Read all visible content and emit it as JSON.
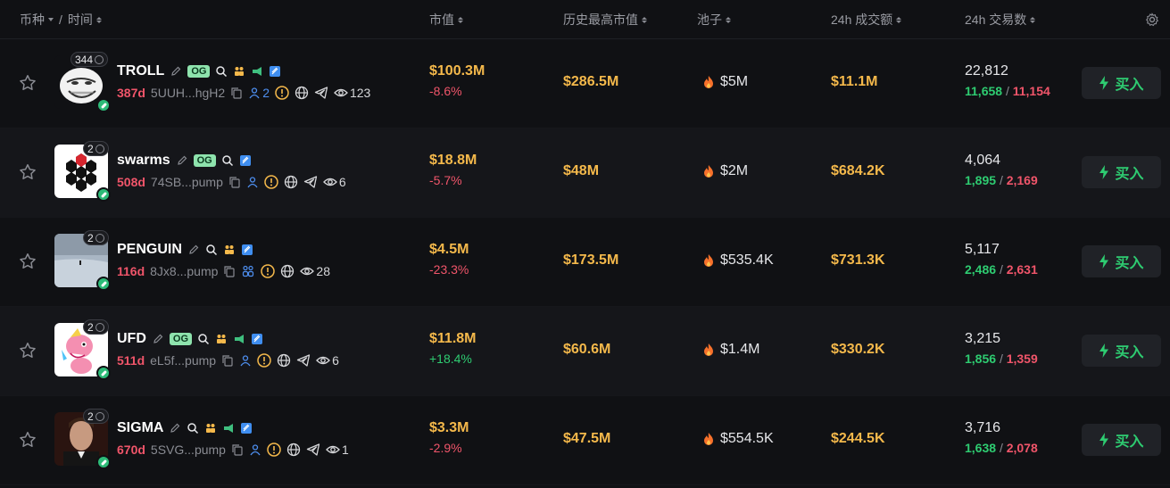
{
  "header": {
    "coin_time": "币种",
    "slash": "/",
    "time": "时间",
    "mcap": "市值",
    "ath": "历史最高市值",
    "pool": "池子",
    "vol24": "24h 成交额",
    "tx24": "24h 交易数"
  },
  "buy_label": "买入",
  "og_label": "OG",
  "rows": [
    {
      "name": "TROLL",
      "badge": "344",
      "age": "387d",
      "address": "5UUH...hgH2",
      "holders": "2",
      "views": "123",
      "mcap": "$100.3M",
      "change": "-8.6%",
      "ath": "$286.5M",
      "pool": "$5M",
      "vol": "$11.1M",
      "tx_total": "22,812",
      "buys": "11,658",
      "sells": "11,154"
    },
    {
      "name": "swarms",
      "badge": "2",
      "age": "508d",
      "address": "74SB...pump",
      "holders": "",
      "views": "6",
      "mcap": "$18.8M",
      "change": "-5.7%",
      "ath": "$48M",
      "pool": "$2M",
      "vol": "$684.2K",
      "tx_total": "4,064",
      "buys": "1,895",
      "sells": "2,169"
    },
    {
      "name": "PENGUIN",
      "badge": "2",
      "age": "116d",
      "address": "8Jx8...pump",
      "holders": "",
      "views": "28",
      "mcap": "$4.5M",
      "change": "-23.3%",
      "ath": "$173.5M",
      "pool": "$535.4K",
      "vol": "$731.3K",
      "tx_total": "5,117",
      "buys": "2,486",
      "sells": "2,631"
    },
    {
      "name": "UFD",
      "badge": "2",
      "age": "511d",
      "address": "eL5f...pump",
      "holders": "",
      "views": "6",
      "mcap": "$11.8M",
      "change": "+18.4%",
      "ath": "$60.6M",
      "pool": "$1.4M",
      "vol": "$330.2K",
      "tx_total": "3,215",
      "buys": "1,856",
      "sells": "1,359"
    },
    {
      "name": "SIGMA",
      "badge": "2",
      "age": "670d",
      "address": "5SVG...pump",
      "holders": "",
      "views": "1",
      "mcap": "$3.3M",
      "change": "-2.9%",
      "ath": "$47.5M",
      "pool": "$554.5K",
      "vol": "$244.5K",
      "tx_total": "3,716",
      "buys": "1,638",
      "sells": "2,078"
    }
  ],
  "colors": {
    "accent_gold": "#f5b94b",
    "positive": "#2ecc71",
    "negative": "#f0556a",
    "og_bg": "#8ee3ad"
  }
}
